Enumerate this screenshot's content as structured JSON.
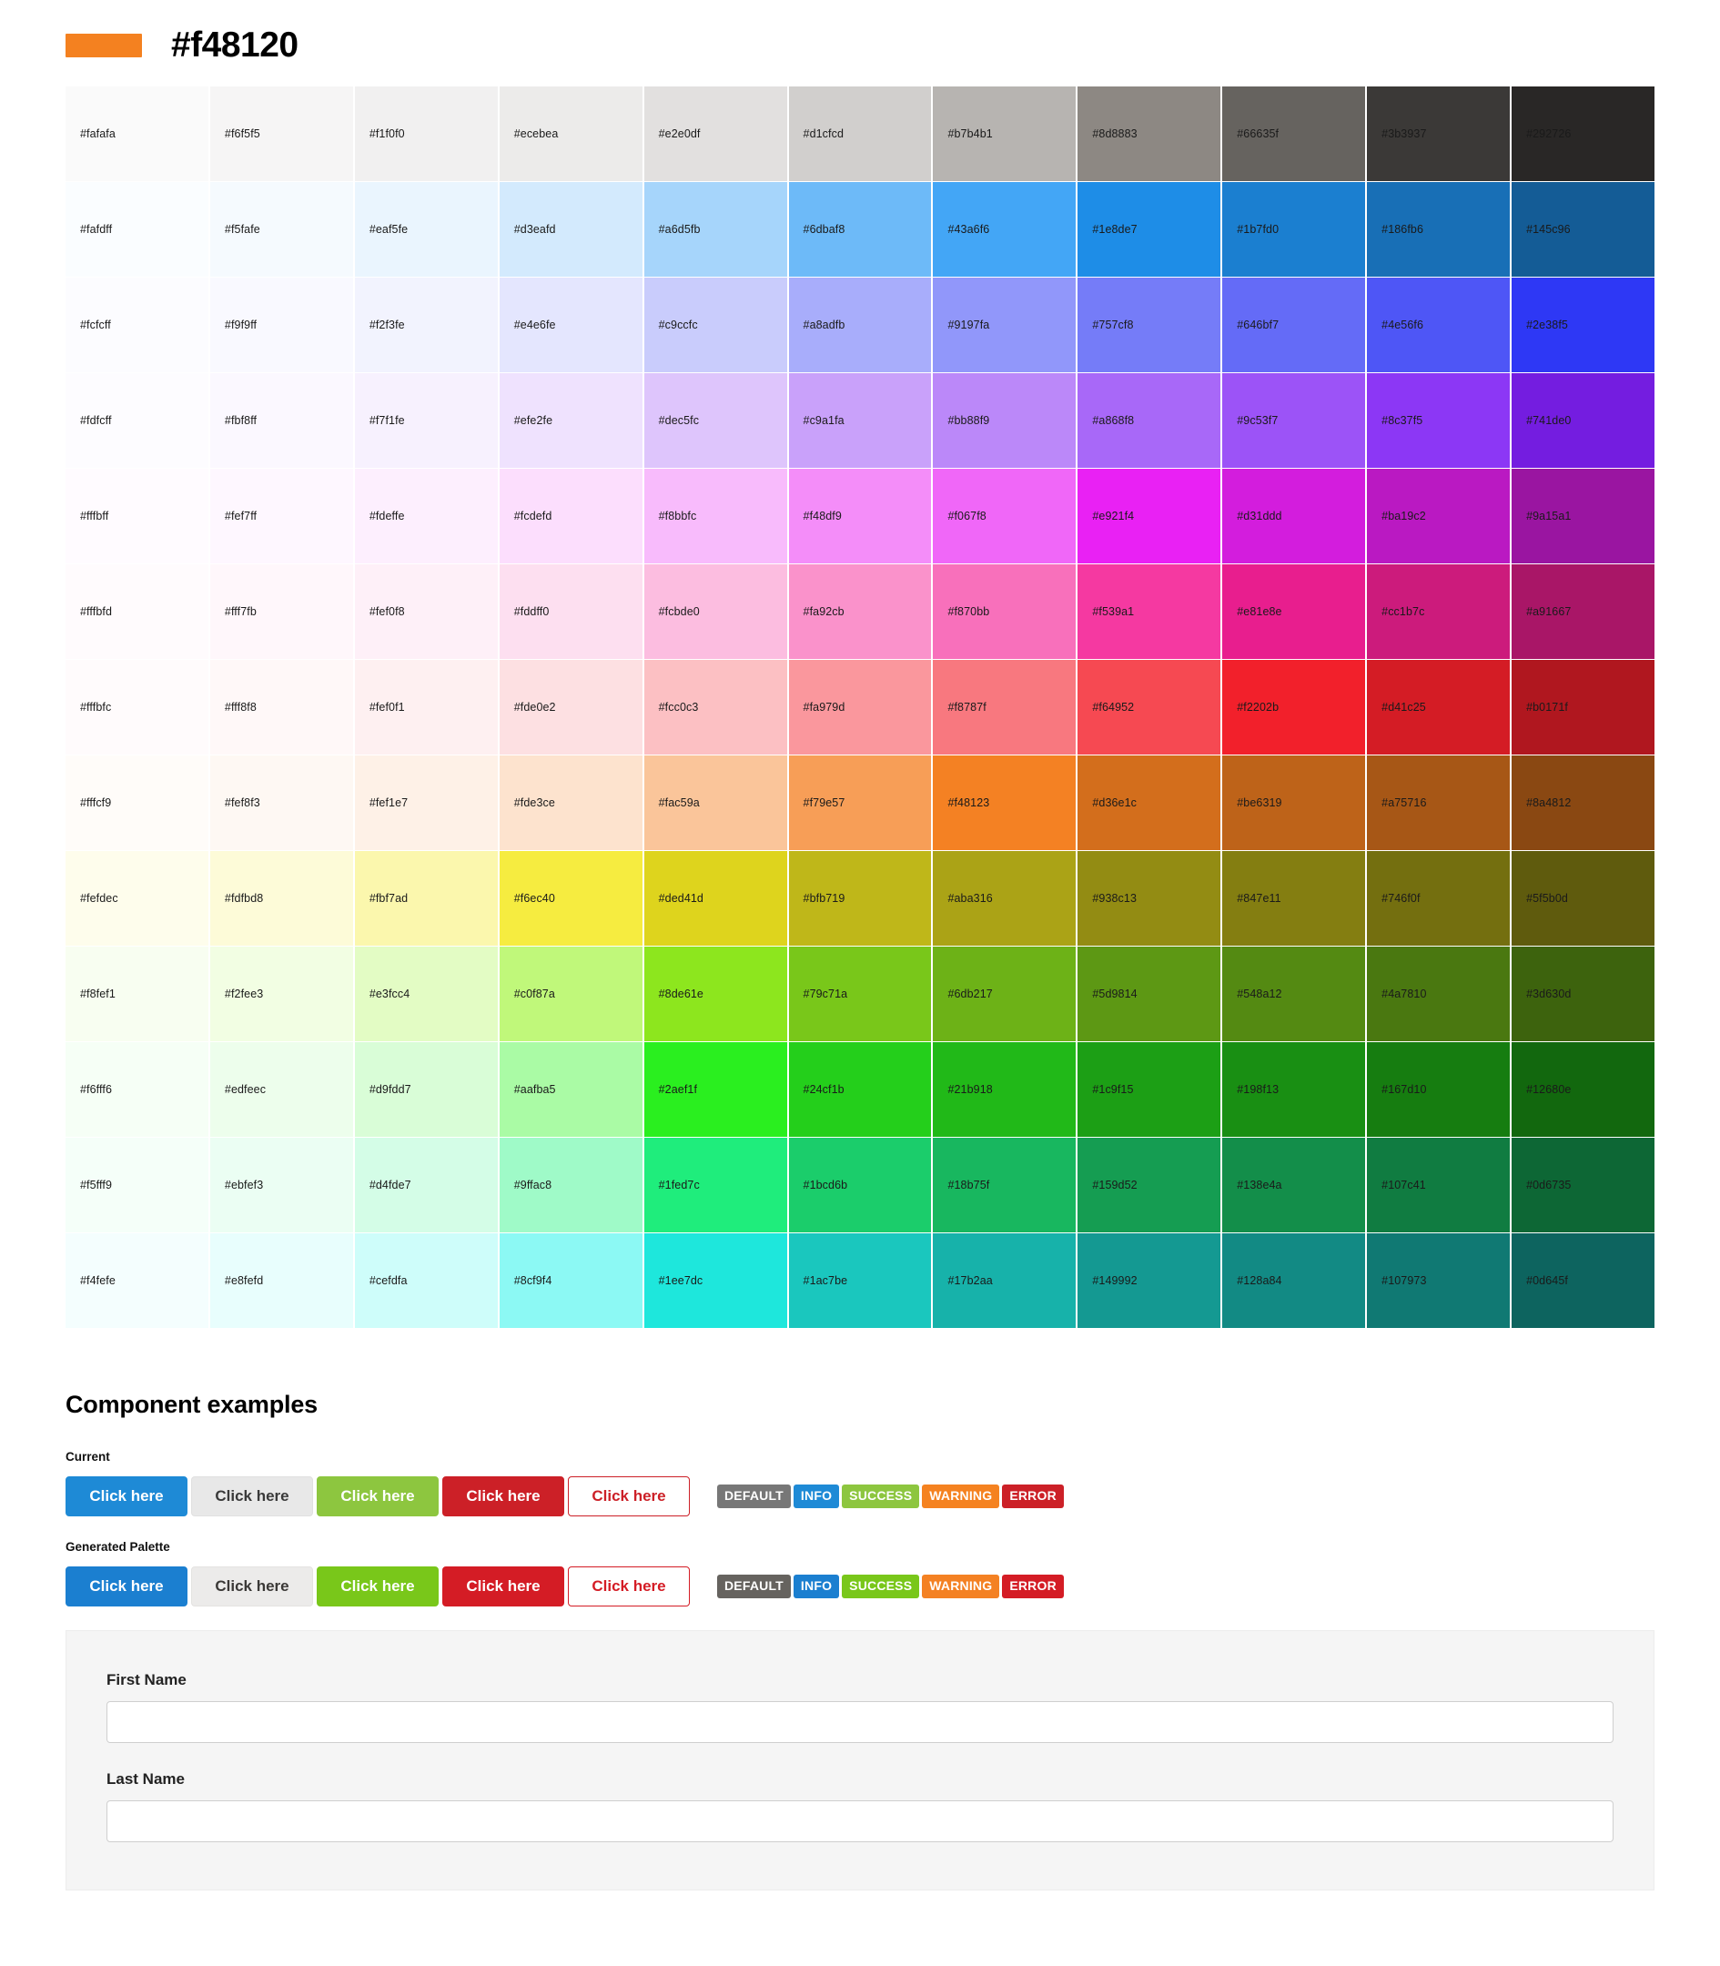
{
  "header": {
    "swatch_color": "#f48120",
    "title": "#f48120"
  },
  "palette": {
    "rows": [
      [
        {
          "hex": "#fafafa",
          "text": "#1a1a1a"
        },
        {
          "hex": "#f6f5f5",
          "text": "#1a1a1a"
        },
        {
          "hex": "#f1f0f0",
          "text": "#1a1a1a"
        },
        {
          "hex": "#ecebea",
          "text": "#1a1a1a"
        },
        {
          "hex": "#e2e0df",
          "text": "#1a1a1a"
        },
        {
          "hex": "#d1cfcd",
          "text": "#1a1a1a"
        },
        {
          "hex": "#b7b4b1",
          "text": "#1a1a1a"
        },
        {
          "hex": "#8d8883",
          "text": "#1a1a1a"
        },
        {
          "hex": "#66635f",
          "text": "#1a1a1a"
        },
        {
          "hex": "#3b3937",
          "text": "#1a1a1a"
        },
        {
          "hex": "#292726",
          "text": "#1a1a1a"
        }
      ],
      [
        {
          "hex": "#fafdff",
          "text": "#1a1a1a"
        },
        {
          "hex": "#f5fafe",
          "text": "#1a1a1a"
        },
        {
          "hex": "#eaf5fe",
          "text": "#1a1a1a"
        },
        {
          "hex": "#d3eafd",
          "text": "#1a1a1a"
        },
        {
          "hex": "#a6d5fb",
          "text": "#1a1a1a"
        },
        {
          "hex": "#6dbaf8",
          "text": "#1a1a1a"
        },
        {
          "hex": "#43a6f6",
          "text": "#1a1a1a"
        },
        {
          "hex": "#1e8de7",
          "text": "#1a1a1a"
        },
        {
          "hex": "#1b7fd0",
          "text": "#1a1a1a"
        },
        {
          "hex": "#186fb6",
          "text": "#1a1a1a"
        },
        {
          "hex": "#145c96",
          "text": "#1a1a1a"
        }
      ],
      [
        {
          "hex": "#fcfcff",
          "text": "#1a1a1a"
        },
        {
          "hex": "#f9f9ff",
          "text": "#1a1a1a"
        },
        {
          "hex": "#f2f3fe",
          "text": "#1a1a1a"
        },
        {
          "hex": "#e4e6fe",
          "text": "#1a1a1a"
        },
        {
          "hex": "#c9ccfc",
          "text": "#1a1a1a"
        },
        {
          "hex": "#a8adfb",
          "text": "#1a1a1a"
        },
        {
          "hex": "#9197fa",
          "text": "#1a1a1a"
        },
        {
          "hex": "#757cf8",
          "text": "#1a1a1a"
        },
        {
          "hex": "#646bf7",
          "text": "#1a1a1a"
        },
        {
          "hex": "#4e56f6",
          "text": "#1a1a1a"
        },
        {
          "hex": "#2e38f5",
          "text": "#1a1a1a"
        }
      ],
      [
        {
          "hex": "#fdfcff",
          "text": "#1a1a1a"
        },
        {
          "hex": "#fbf8ff",
          "text": "#1a1a1a"
        },
        {
          "hex": "#f7f1fe",
          "text": "#1a1a1a"
        },
        {
          "hex": "#efe2fe",
          "text": "#1a1a1a"
        },
        {
          "hex": "#dec5fc",
          "text": "#1a1a1a"
        },
        {
          "hex": "#c9a1fa",
          "text": "#1a1a1a"
        },
        {
          "hex": "#bb88f9",
          "text": "#1a1a1a"
        },
        {
          "hex": "#a868f8",
          "text": "#1a1a1a"
        },
        {
          "hex": "#9c53f7",
          "text": "#1a1a1a"
        },
        {
          "hex": "#8c37f5",
          "text": "#1a1a1a"
        },
        {
          "hex": "#741de0",
          "text": "#1a1a1a"
        }
      ],
      [
        {
          "hex": "#fffbff",
          "text": "#1a1a1a"
        },
        {
          "hex": "#fef7ff",
          "text": "#1a1a1a"
        },
        {
          "hex": "#fdeffe",
          "text": "#1a1a1a"
        },
        {
          "hex": "#fcdefd",
          "text": "#1a1a1a"
        },
        {
          "hex": "#f8bbfc",
          "text": "#1a1a1a"
        },
        {
          "hex": "#f48df9",
          "text": "#1a1a1a"
        },
        {
          "hex": "#f067f8",
          "text": "#1a1a1a"
        },
        {
          "hex": "#e921f4",
          "text": "#1a1a1a"
        },
        {
          "hex": "#d31ddd",
          "text": "#1a1a1a"
        },
        {
          "hex": "#ba19c2",
          "text": "#1a1a1a"
        },
        {
          "hex": "#9a15a1",
          "text": "#1a1a1a"
        }
      ],
      [
        {
          "hex": "#fffbfd",
          "text": "#1a1a1a"
        },
        {
          "hex": "#fff7fb",
          "text": "#1a1a1a"
        },
        {
          "hex": "#fef0f8",
          "text": "#1a1a1a"
        },
        {
          "hex": "#fddff0",
          "text": "#1a1a1a"
        },
        {
          "hex": "#fcbde0",
          "text": "#1a1a1a"
        },
        {
          "hex": "#fa92cb",
          "text": "#1a1a1a"
        },
        {
          "hex": "#f870bb",
          "text": "#1a1a1a"
        },
        {
          "hex": "#f539a1",
          "text": "#1a1a1a"
        },
        {
          "hex": "#e81e8e",
          "text": "#1a1a1a"
        },
        {
          "hex": "#cc1b7c",
          "text": "#1a1a1a"
        },
        {
          "hex": "#a91667",
          "text": "#1a1a1a"
        }
      ],
      [
        {
          "hex": "#fffbfc",
          "text": "#1a1a1a"
        },
        {
          "hex": "#fff8f8",
          "text": "#1a1a1a"
        },
        {
          "hex": "#fef0f1",
          "text": "#1a1a1a"
        },
        {
          "hex": "#fde0e2",
          "text": "#1a1a1a"
        },
        {
          "hex": "#fcc0c3",
          "text": "#1a1a1a"
        },
        {
          "hex": "#fa979d",
          "text": "#1a1a1a"
        },
        {
          "hex": "#f8787f",
          "text": "#1a1a1a"
        },
        {
          "hex": "#f64952",
          "text": "#1a1a1a"
        },
        {
          "hex": "#f2202b",
          "text": "#1a1a1a"
        },
        {
          "hex": "#d41c25",
          "text": "#1a1a1a"
        },
        {
          "hex": "#b0171f",
          "text": "#1a1a1a"
        }
      ],
      [
        {
          "hex": "#fffcf9",
          "text": "#1a1a1a"
        },
        {
          "hex": "#fef8f3",
          "text": "#1a1a1a"
        },
        {
          "hex": "#fef1e7",
          "text": "#1a1a1a"
        },
        {
          "hex": "#fde3ce",
          "text": "#1a1a1a"
        },
        {
          "hex": "#fac59a",
          "text": "#1a1a1a"
        },
        {
          "hex": "#f79e57",
          "text": "#1a1a1a"
        },
        {
          "hex": "#f48123",
          "text": "#1a1a1a"
        },
        {
          "hex": "#d36e1c",
          "text": "#1a1a1a"
        },
        {
          "hex": "#be6319",
          "text": "#1a1a1a"
        },
        {
          "hex": "#a75716",
          "text": "#1a1a1a"
        },
        {
          "hex": "#8a4812",
          "text": "#1a1a1a"
        }
      ],
      [
        {
          "hex": "#fefdec",
          "text": "#1a1a1a"
        },
        {
          "hex": "#fdfbd8",
          "text": "#1a1a1a"
        },
        {
          "hex": "#fbf7ad",
          "text": "#1a1a1a"
        },
        {
          "hex": "#f6ec40",
          "text": "#1a1a1a"
        },
        {
          "hex": "#ded41d",
          "text": "#1a1a1a"
        },
        {
          "hex": "#bfb719",
          "text": "#1a1a1a"
        },
        {
          "hex": "#aba316",
          "text": "#1a1a1a"
        },
        {
          "hex": "#938c13",
          "text": "#1a1a1a"
        },
        {
          "hex": "#847e11",
          "text": "#1a1a1a"
        },
        {
          "hex": "#746f0f",
          "text": "#1a1a1a"
        },
        {
          "hex": "#5f5b0d",
          "text": "#1a1a1a"
        }
      ],
      [
        {
          "hex": "#f8fef1",
          "text": "#1a1a1a"
        },
        {
          "hex": "#f2fee3",
          "text": "#1a1a1a"
        },
        {
          "hex": "#e3fcc4",
          "text": "#1a1a1a"
        },
        {
          "hex": "#c0f87a",
          "text": "#1a1a1a"
        },
        {
          "hex": "#8de61e",
          "text": "#1a1a1a"
        },
        {
          "hex": "#79c71a",
          "text": "#1a1a1a"
        },
        {
          "hex": "#6db217",
          "text": "#1a1a1a"
        },
        {
          "hex": "#5d9814",
          "text": "#1a1a1a"
        },
        {
          "hex": "#548a12",
          "text": "#1a1a1a"
        },
        {
          "hex": "#4a7810",
          "text": "#1a1a1a"
        },
        {
          "hex": "#3d630d",
          "text": "#1a1a1a"
        }
      ],
      [
        {
          "hex": "#f6fff6",
          "text": "#1a1a1a"
        },
        {
          "hex": "#edfeec",
          "text": "#1a1a1a"
        },
        {
          "hex": "#d9fdd7",
          "text": "#1a1a1a"
        },
        {
          "hex": "#aafba5",
          "text": "#1a1a1a"
        },
        {
          "hex": "#2aef1f",
          "text": "#1a1a1a"
        },
        {
          "hex": "#24cf1b",
          "text": "#1a1a1a"
        },
        {
          "hex": "#21b918",
          "text": "#1a1a1a"
        },
        {
          "hex": "#1c9f15",
          "text": "#1a1a1a"
        },
        {
          "hex": "#198f13",
          "text": "#1a1a1a"
        },
        {
          "hex": "#167d10",
          "text": "#1a1a1a"
        },
        {
          "hex": "#12680e",
          "text": "#1a1a1a"
        }
      ],
      [
        {
          "hex": "#f5fff9",
          "text": "#1a1a1a"
        },
        {
          "hex": "#ebfef3",
          "text": "#1a1a1a"
        },
        {
          "hex": "#d4fde7",
          "text": "#1a1a1a"
        },
        {
          "hex": "#9ffac8",
          "text": "#1a1a1a"
        },
        {
          "hex": "#1fed7c",
          "text": "#1a1a1a"
        },
        {
          "hex": "#1bcd6b",
          "text": "#1a1a1a"
        },
        {
          "hex": "#18b75f",
          "text": "#1a1a1a"
        },
        {
          "hex": "#159d52",
          "text": "#1a1a1a"
        },
        {
          "hex": "#138e4a",
          "text": "#1a1a1a"
        },
        {
          "hex": "#107c41",
          "text": "#1a1a1a"
        },
        {
          "hex": "#0d6735",
          "text": "#1a1a1a"
        }
      ],
      [
        {
          "hex": "#f4fefe",
          "text": "#1a1a1a"
        },
        {
          "hex": "#e8fefd",
          "text": "#1a1a1a"
        },
        {
          "hex": "#cefdfa",
          "text": "#1a1a1a"
        },
        {
          "hex": "#8cf9f4",
          "text": "#1a1a1a"
        },
        {
          "hex": "#1ee7dc",
          "text": "#1a1a1a"
        },
        {
          "hex": "#1ac7be",
          "text": "#1a1a1a"
        },
        {
          "hex": "#17b2aa",
          "text": "#1a1a1a"
        },
        {
          "hex": "#149992",
          "text": "#1a1a1a"
        },
        {
          "hex": "#128a84",
          "text": "#1a1a1a"
        },
        {
          "hex": "#107973",
          "text": "#1a1a1a"
        },
        {
          "hex": "#0d645f",
          "text": "#1a1a1a"
        }
      ]
    ]
  },
  "components": {
    "section_title": "Component examples",
    "current_label": "Current",
    "generated_label": "Generated Palette",
    "buttons": [
      {
        "label": "Click here",
        "variant": "primary"
      },
      {
        "label": "Click here",
        "variant": "default"
      },
      {
        "label": "Click here",
        "variant": "success"
      },
      {
        "label": "Click here",
        "variant": "danger"
      },
      {
        "label": "Click here",
        "variant": "outline"
      }
    ],
    "labels": [
      {
        "text": "DEFAULT",
        "variant": "default"
      },
      {
        "text": "INFO",
        "variant": "info"
      },
      {
        "text": "SUCCESS",
        "variant": "success"
      },
      {
        "text": "WARNING",
        "variant": "warning"
      },
      {
        "text": "ERROR",
        "variant": "error"
      }
    ],
    "form": {
      "first_name_label": "First Name",
      "first_name_value": "",
      "first_name_placeholder": "",
      "last_name_label": "Last Name",
      "last_name_value": "",
      "last_name_placeholder": ""
    }
  }
}
